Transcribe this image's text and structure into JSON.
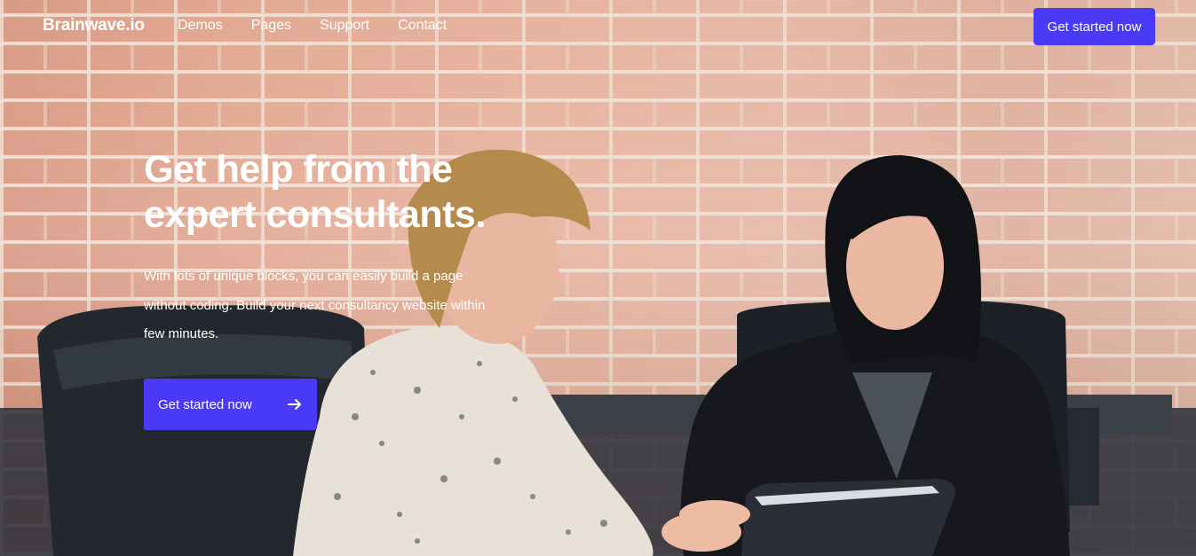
{
  "brand": {
    "name": "Brainwave.io"
  },
  "nav": {
    "items": [
      {
        "label": "Demos"
      },
      {
        "label": "Pages"
      },
      {
        "label": "Support"
      },
      {
        "label": "Contact"
      }
    ]
  },
  "header": {
    "cta_label": "Get started now"
  },
  "hero": {
    "title_line1": "Get help from the",
    "title_line2": "expert consultants.",
    "description": "With lots of unique blocks, you can easily build a page without coding. Build your next consultancy website within few minutes.",
    "cta_label": "Get started now",
    "cta_icon": "arrow-right-icon"
  },
  "colors": {
    "accent": "#4a3af5",
    "text": "#ffffff"
  }
}
